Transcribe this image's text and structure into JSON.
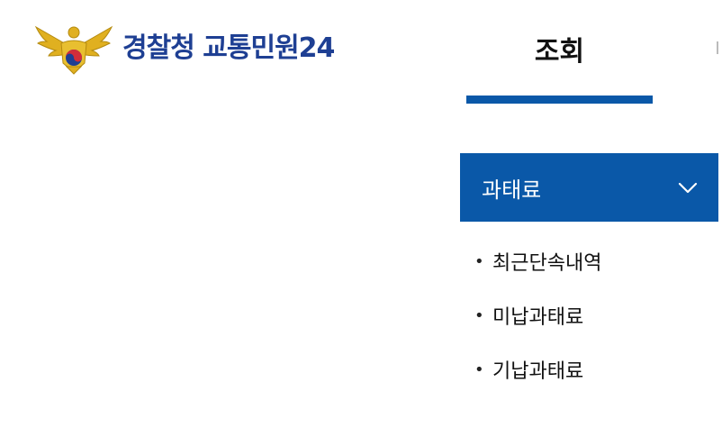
{
  "header": {
    "logo_agency": "경찰청",
    "logo_service": "교통민원24"
  },
  "nav": {
    "active_tab": "조회"
  },
  "menu": {
    "header_label": "과태료",
    "header_icon": "chevron-down-icon",
    "items": [
      {
        "label": "최근단속내역"
      },
      {
        "label": "미납과태료"
      },
      {
        "label": "기납과태료"
      }
    ]
  },
  "colors": {
    "brand_blue": "#0a58a8",
    "logo_blue": "#1e3f93",
    "emblem_gold": "#e0b020",
    "emblem_red": "#d22d3a"
  }
}
